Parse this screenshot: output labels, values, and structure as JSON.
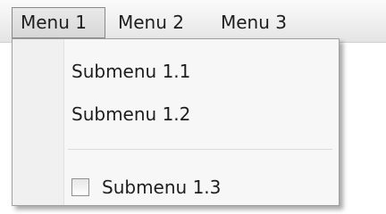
{
  "menubar": {
    "items": [
      {
        "label": "Menu 1",
        "state": "open"
      },
      {
        "label": "Menu 2"
      },
      {
        "label": "Menu 3"
      }
    ]
  },
  "dropdown": {
    "items": [
      {
        "label": "Submenu 1.1"
      },
      {
        "label": "Submenu 1.2"
      },
      {
        "label": "Submenu 1.3",
        "type": "checkbox",
        "checked": false
      }
    ]
  }
}
